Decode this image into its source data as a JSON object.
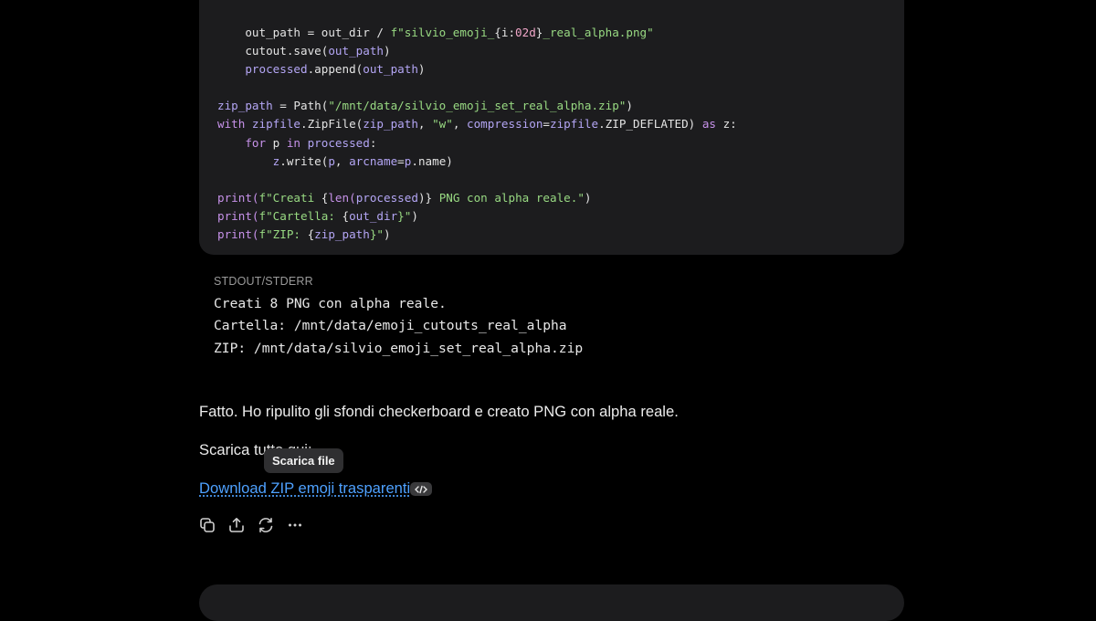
{
  "code": {
    "lines": [
      [
        {
          "t": "    out_path = out_dir / ",
          "c": "op"
        },
        {
          "t": "f\"silvio_emoji_",
          "c": "st"
        },
        {
          "t": "{i:",
          "c": "op"
        },
        {
          "t": "02d",
          "c": "nu"
        },
        {
          "t": "}",
          "c": "op"
        },
        {
          "t": "_real_alpha.png\"",
          "c": "st"
        }
      ],
      [
        {
          "t": "    cutout.save(",
          "c": "op"
        },
        {
          "t": "out_path",
          "c": "vr"
        },
        {
          "t": ")",
          "c": "op"
        }
      ],
      [
        {
          "t": "    processed",
          "c": "vr"
        },
        {
          "t": ".append(",
          "c": "op"
        },
        {
          "t": "out_path",
          "c": "vr"
        },
        {
          "t": ")",
          "c": "op"
        }
      ],
      [
        {
          "t": "",
          "c": "op"
        }
      ],
      [
        {
          "t": "zip_path",
          "c": "vr"
        },
        {
          "t": " = Path(",
          "c": "op"
        },
        {
          "t": "\"/mnt/data/silvio_emoji_set_real_alpha.zip\"",
          "c": "st"
        },
        {
          "t": ")",
          "c": "op"
        }
      ],
      [
        {
          "t": "with ",
          "c": "kw"
        },
        {
          "t": "zipfile",
          "c": "vr"
        },
        {
          "t": ".ZipFile(",
          "c": "op"
        },
        {
          "t": "zip_path",
          "c": "vr"
        },
        {
          "t": ", ",
          "c": "op"
        },
        {
          "t": "\"w\"",
          "c": "st"
        },
        {
          "t": ", ",
          "c": "op"
        },
        {
          "t": "compression",
          "c": "vr"
        },
        {
          "t": "=",
          "c": "op"
        },
        {
          "t": "zipfile",
          "c": "vr"
        },
        {
          "t": ".ZIP_DEFLATED) ",
          "c": "op"
        },
        {
          "t": "as ",
          "c": "kw"
        },
        {
          "t": "z:",
          "c": "op"
        }
      ],
      [
        {
          "t": "    for ",
          "c": "kw"
        },
        {
          "t": "p ",
          "c": "op"
        },
        {
          "t": "in ",
          "c": "kw"
        },
        {
          "t": "processed",
          "c": "vr"
        },
        {
          "t": ":",
          "c": "op"
        }
      ],
      [
        {
          "t": "        z",
          "c": "vr"
        },
        {
          "t": ".write(",
          "c": "op"
        },
        {
          "t": "p",
          "c": "vr"
        },
        {
          "t": ", ",
          "c": "op"
        },
        {
          "t": "arcname",
          "c": "vr"
        },
        {
          "t": "=",
          "c": "op"
        },
        {
          "t": "p",
          "c": "vr"
        },
        {
          "t": ".name)",
          "c": "op"
        }
      ],
      [
        {
          "t": "",
          "c": "op"
        }
      ],
      [
        {
          "t": "print(",
          "c": "kw"
        },
        {
          "t": "f\"Creati ",
          "c": "st"
        },
        {
          "t": "{",
          "c": "op"
        },
        {
          "t": "len(",
          "c": "kw"
        },
        {
          "t": "processed",
          "c": "vr"
        },
        {
          "t": ")}",
          "c": "op"
        },
        {
          "t": " PNG con alpha reale.\"",
          "c": "st"
        },
        {
          "t": ")",
          "c": "op"
        }
      ],
      [
        {
          "t": "print(",
          "c": "kw"
        },
        {
          "t": "f\"Cartella: ",
          "c": "st"
        },
        {
          "t": "{",
          "c": "op"
        },
        {
          "t": "out_dir",
          "c": "vr"
        },
        {
          "t": "}\"",
          "c": "st"
        },
        {
          "t": ")",
          "c": "op"
        }
      ],
      [
        {
          "t": "print(",
          "c": "kw"
        },
        {
          "t": "f\"ZIP: ",
          "c": "st"
        },
        {
          "t": "{",
          "c": "op"
        },
        {
          "t": "zip_path",
          "c": "vr"
        },
        {
          "t": "}\"",
          "c": "st"
        },
        {
          "t": ")",
          "c": "op"
        }
      ]
    ]
  },
  "stdout": {
    "label": "STDOUT/STDERR",
    "text": "Creati 8 PNG con alpha reale.\nCartella: /mnt/data/emoji_cutouts_real_alpha\nZIP: /mnt/data/silvio_emoji_set_real_alpha.zip"
  },
  "message": {
    "line1": "Fatto. Ho ripulito gli sfondi checkerboard e creato PNG con alpha reale.",
    "line2": "Scarica tutto qui:",
    "download_link": "Download ZIP emoji trasparenti",
    "tooltip": "Scarica file"
  },
  "actions": [
    {
      "name": "copy-icon"
    },
    {
      "name": "share-icon"
    },
    {
      "name": "regenerate-icon"
    },
    {
      "name": "more-icon"
    }
  ],
  "colors": {
    "background": "#000000",
    "code_bg": "#1c1c1e",
    "link": "#4ea1ff"
  }
}
